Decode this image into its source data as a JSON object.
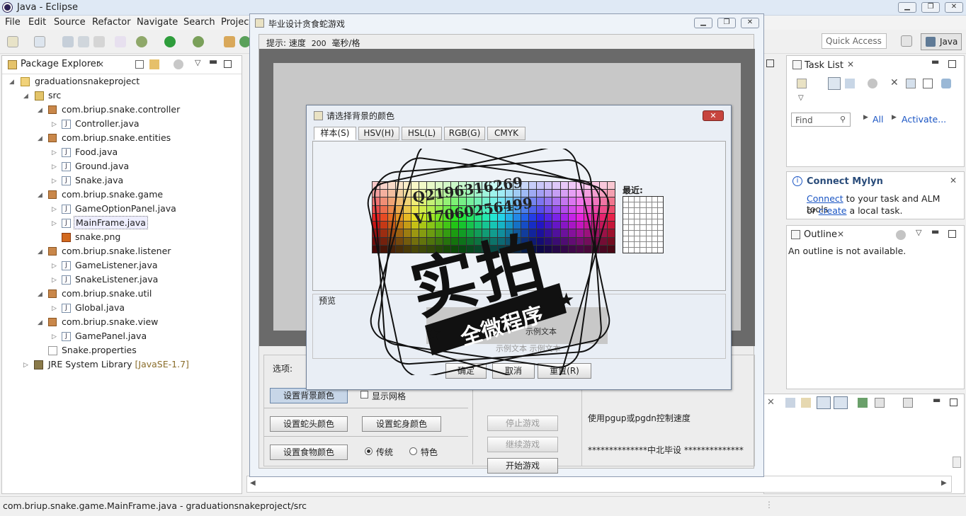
{
  "eclipse": {
    "title": "Java - Eclipse",
    "menus": [
      "File",
      "Edit",
      "Source",
      "Refactor",
      "Navigate",
      "Search",
      "Project"
    ],
    "quick_access": "Quick Access",
    "perspective": "Java",
    "status": "com.briup.snake.game.MainFrame.java - graduationsnakeproject/src"
  },
  "package_explorer": {
    "tab": "Package Explorer",
    "items": [
      "graduationsnakeproject",
      "src",
      "com.briup.snake.controller",
      "Controller.java",
      "com.briup.snake.entities",
      "Food.java",
      "Ground.java",
      "Snake.java",
      "com.briup.snake.game",
      "GameOptionPanel.java",
      "MainFrame.java",
      "snake.png",
      "com.briup.snake.listener",
      "GameListener.java",
      "SnakeListener.java",
      "com.briup.snake.util",
      "Global.java",
      "com.briup.snake.view",
      "GamePanel.java",
      "Snake.properties",
      "JRE System Library",
      "[JavaSE-1.7]"
    ]
  },
  "task_list": {
    "tab": "Task List",
    "find_placeholder": "Find",
    "all": "All",
    "activate": "Activate..."
  },
  "mylyn": {
    "title": "Connect Mylyn",
    "connect": "Connect",
    "line1_rest": "to your task and ALM tools",
    "or": "or",
    "create": "create",
    "line2_rest": "a local task."
  },
  "outline": {
    "tab": "Outline",
    "message": "An outline is not available."
  },
  "snake_window": {
    "title": "毕业设计贪食蛇游戏",
    "hint_label": "提示: 速度",
    "speed": "200",
    "speed_unit": "毫秒/格",
    "options_label": "选项:",
    "btn_bg_color": "设置背景颜色",
    "checkbox_grid": "显示网格",
    "btn_head_color": "设置蛇头颜色",
    "btn_body_color": "设置蛇身颜色",
    "btn_food_color": "设置食物颜色",
    "radio_traditional": "传统",
    "radio_special": "特色",
    "btn_stop": "停止游戏",
    "btn_continue": "继续游戏",
    "btn_start": "开始游戏",
    "info_speed": "使用pgup或pgdn控制速度",
    "info_footer": "**************中北毕设 **************"
  },
  "color_dialog": {
    "title": "请选择背景的颜色",
    "tabs": [
      "样本(S)",
      "HSV(H)",
      "HSL(L)",
      "RGB(G)",
      "CMYK"
    ],
    "recent_label": "最近:",
    "preview_label": "预览",
    "sample_text_1": "示例文本",
    "sample_text_2": "示例文本  示例文本",
    "btn_ok": "确定",
    "btn_cancel": "取消",
    "btn_reset": "重置(R)"
  },
  "watermark": {
    "line1": "Q2196316269",
    "line2": "V17060256499",
    "big": "实拍",
    "banner": "全微程序"
  }
}
